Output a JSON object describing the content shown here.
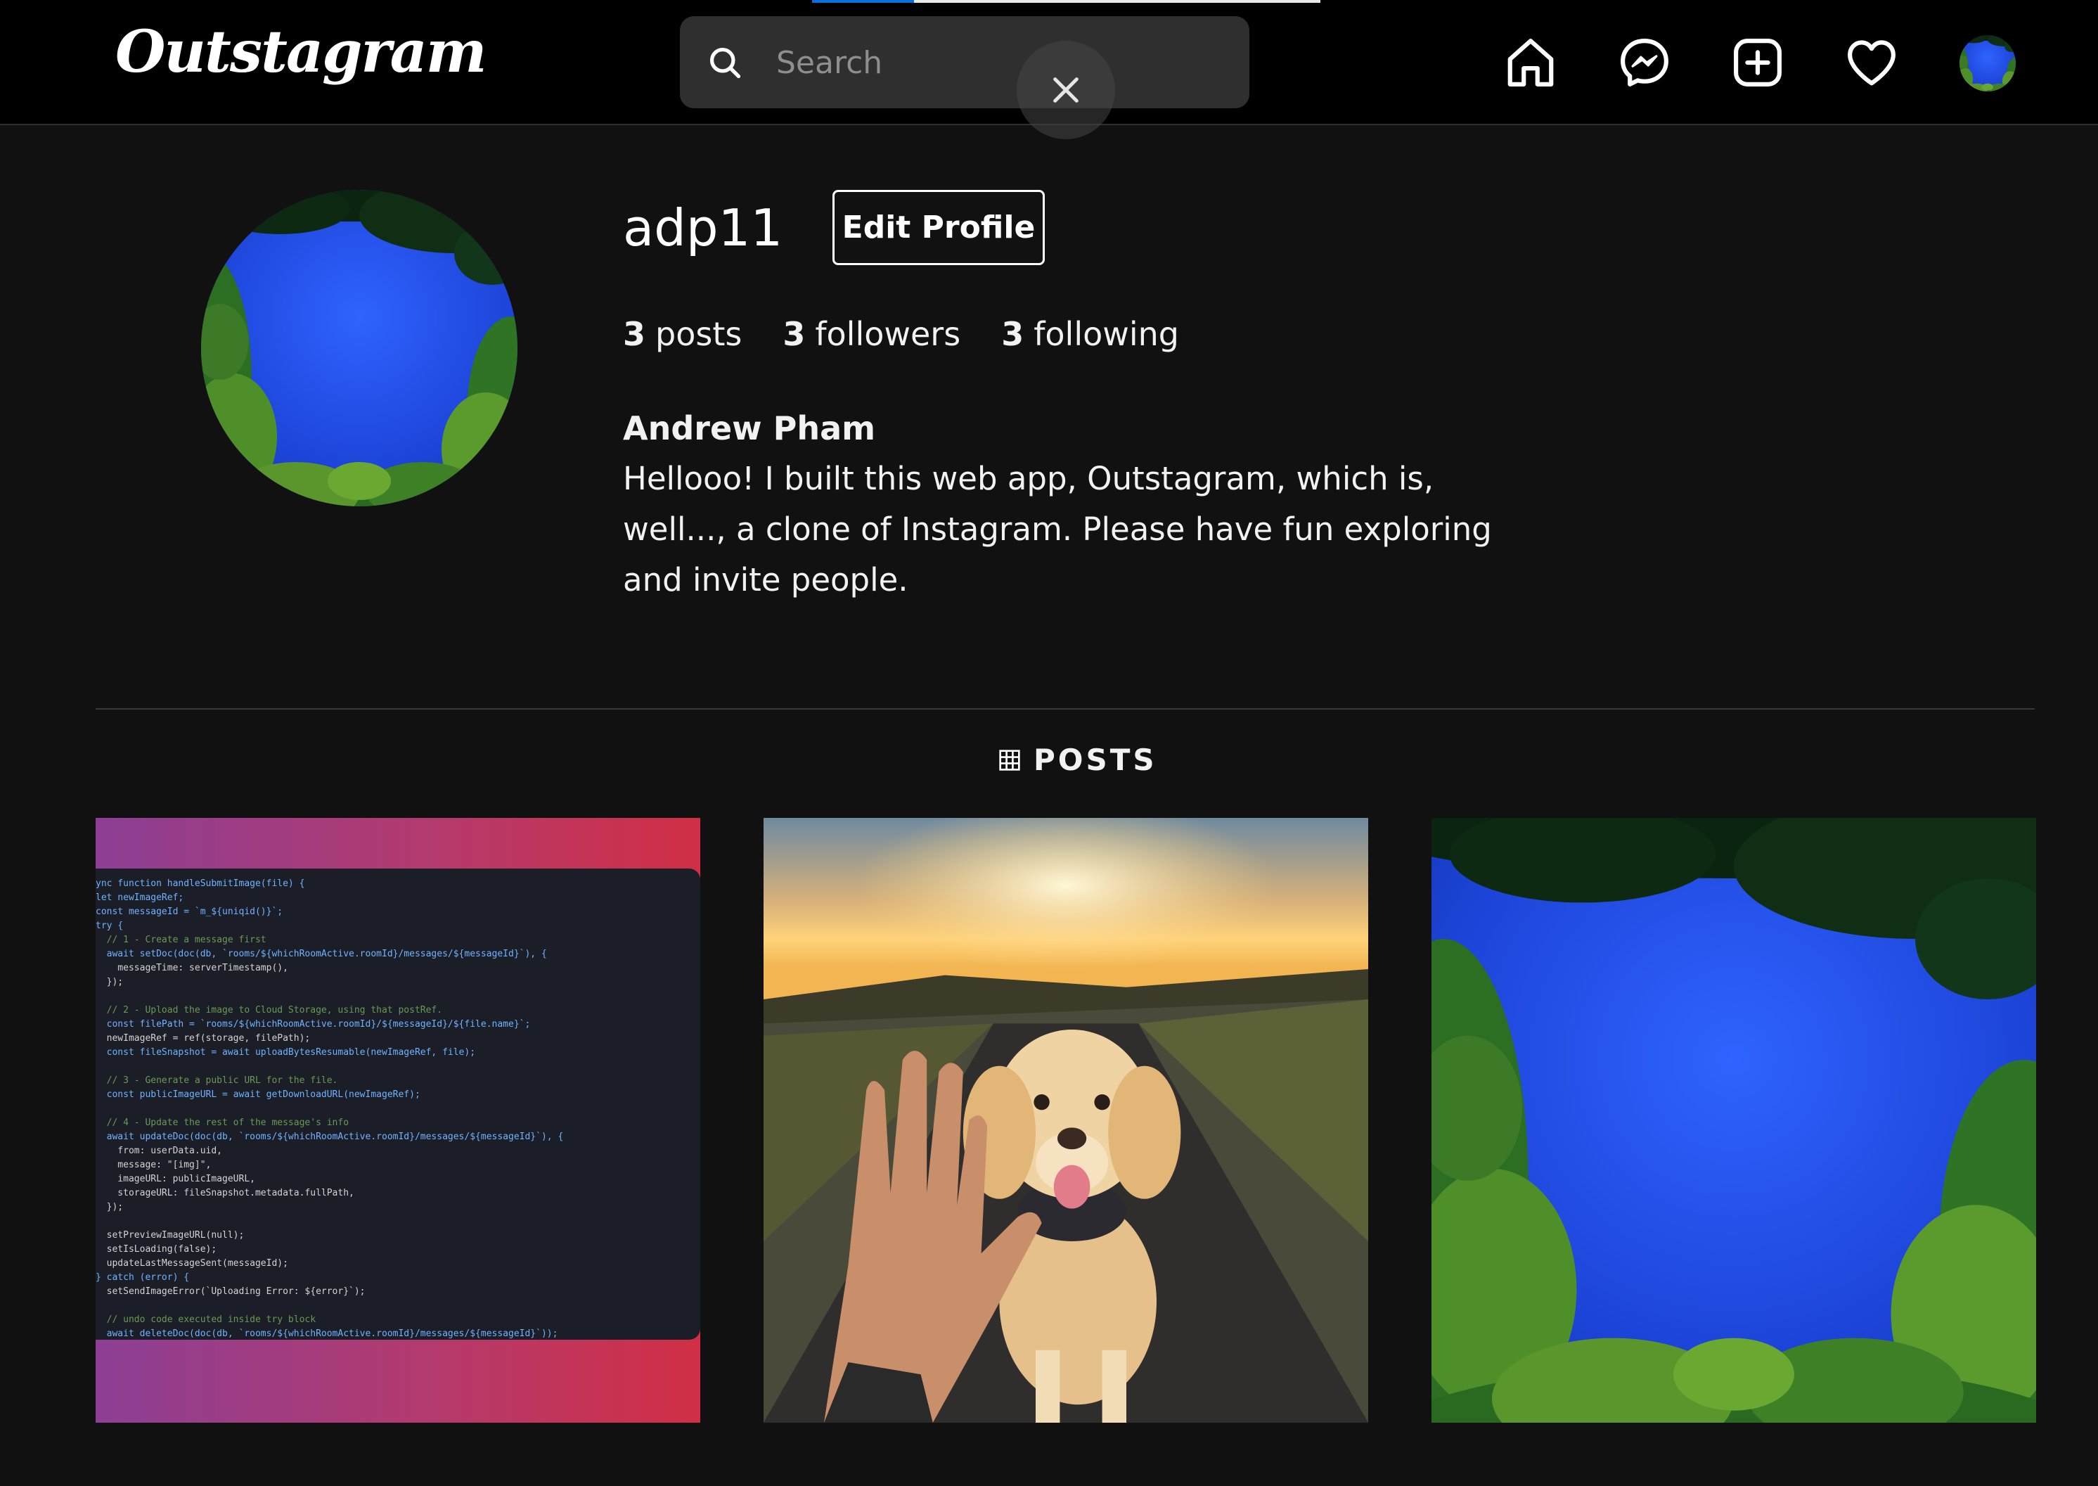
{
  "app": {
    "logo_text": "Outstagram",
    "loading_progress": 0.2
  },
  "search": {
    "placeholder": "Search",
    "value": ""
  },
  "nav": {
    "icons": [
      "home-icon",
      "messenger-icon",
      "new-post-icon",
      "heart-icon",
      "avatar"
    ]
  },
  "profile": {
    "username": "adp11",
    "edit_label": "Edit Profile",
    "posts_count": "3",
    "posts_label": "posts",
    "followers_count": "3",
    "followers_label": "followers",
    "following_count": "3",
    "following_label": "following",
    "full_name": "Andrew Pham",
    "bio": "Hellooo! I built this web app, Outstagram, which is, well..., a clone of Instagram. Please have fun exploring and invite people."
  },
  "tabs": {
    "posts_label": "POSTS"
  },
  "posts": [
    {
      "kind": "code-screenshot",
      "code_lines": [
        "ync function handleSubmitImage(file) {",
        "let newImageRef;",
        "const messageId = `m_${uniqid()}`;",
        "try {",
        "  // 1 - Create a message first",
        "  await setDoc(doc(db, `rooms/${whichRoomActive.roomId}/messages/${messageId}`), {",
        "    messageTime: serverTimestamp(),",
        "  });",
        "",
        "  // 2 - Upload the image to Cloud Storage, using that postRef.",
        "  const filePath = `rooms/${whichRoomActive.roomId}/${messageId}/${file.name}`;",
        "  newImageRef = ref(storage, filePath);",
        "  const fileSnapshot = await uploadBytesResumable(newImageRef, file);",
        "",
        "  // 3 - Generate a public URL for the file.",
        "  const publicImageURL = await getDownloadURL(newImageRef);",
        "",
        "  // 4 - Update the rest of the message's info",
        "  await updateDoc(doc(db, `rooms/${whichRoomActive.roomId}/messages/${messageId}`), {",
        "    from: userData.uid,",
        "    message: \"[img]\",",
        "    imageURL: publicImageURL,",
        "    storageURL: fileSnapshot.metadata.fullPath,",
        "  });",
        "",
        "  setPreviewImageURL(null);",
        "  setIsLoading(false);",
        "  updateLastMessageSent(messageId);",
        "} catch (error) {",
        "  setSendImageError(`Uploading Error: ${error}`);",
        "",
        "  // undo code executed inside try block",
        "  await deleteDoc(doc(db, `rooms/${whichRoomActive.roomId}/messages/${messageId}`));"
      ]
    },
    {
      "kind": "dog-high-five-photo"
    },
    {
      "kind": "tree-canopy-sky-photo"
    }
  ],
  "colors": {
    "background": "#111111",
    "topbar": "#000000",
    "search_bg": "#2f2f2f",
    "accent_blue": "#0a6fd8"
  }
}
